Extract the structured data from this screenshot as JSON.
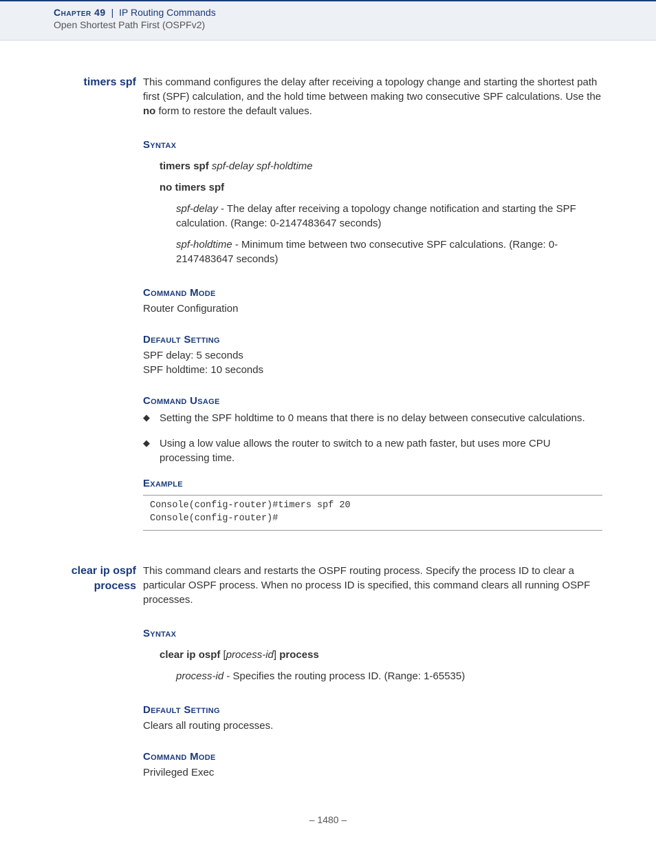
{
  "header": {
    "chapter": "Chapter 49",
    "separator": "|",
    "title": "IP Routing Commands",
    "subtitle": "Open Shortest Path First (OSPFv2)"
  },
  "cmd1": {
    "name": "timers spf",
    "desc_p1": "This command configures the delay after receiving a topology change and starting the shortest path first (SPF) calculation, and the hold time between making two consecutive SPF calculations. Use the ",
    "desc_no": "no",
    "desc_p2": " form to restore the default values.",
    "syntax_head": "Syntax",
    "syntax1_cmd": "timers spf",
    "syntax1_args": "spf-delay spf-holdtime",
    "syntax2": "no timers spf",
    "param1_name": "spf-delay",
    "param1_text": " - The delay after receiving a topology change notification and starting the SPF calculation. (Range: 0-2147483647 seconds)",
    "param2_name": "spf-holdtime",
    "param2_text": " - Minimum time between two consecutive SPF calculations. (Range: 0-2147483647 seconds)",
    "mode_head": "Command Mode",
    "mode_text": "Router Configuration",
    "default_head": "Default Setting",
    "default_l1": "SPF delay: 5 seconds",
    "default_l2": "SPF holdtime: 10 seconds",
    "usage_head": "Command Usage",
    "usage_b1": "Setting the SPF holdtime to 0 means that there is no delay between consecutive calculations.",
    "usage_b2": "Using a low value allows the router to switch to a new path faster, but uses more CPU processing time.",
    "example_head": "Example",
    "example_code": "Console(config-router)#timers spf 20\nConsole(config-router)#"
  },
  "cmd2": {
    "name": "clear ip ospf process",
    "desc": "This command clears and restarts the OSPF routing process. Specify the process ID to clear a particular OSPF process. When no process ID is specified, this command clears all running OSPF processes.",
    "syntax_head": "Syntax",
    "syntax_cmd1": "clear ip ospf",
    "syntax_arg": "process-id",
    "syntax_cmd2": "process",
    "param_name": "process-id",
    "param_text": " - Specifies the routing process ID. (Range: 1-65535)",
    "default_head": "Default Setting",
    "default_text": "Clears all routing processes.",
    "mode_head": "Command Mode",
    "mode_text": "Privileged Exec"
  },
  "footer": {
    "page_prefix": "–  ",
    "page_num": "1480",
    "page_suffix": "  –"
  }
}
